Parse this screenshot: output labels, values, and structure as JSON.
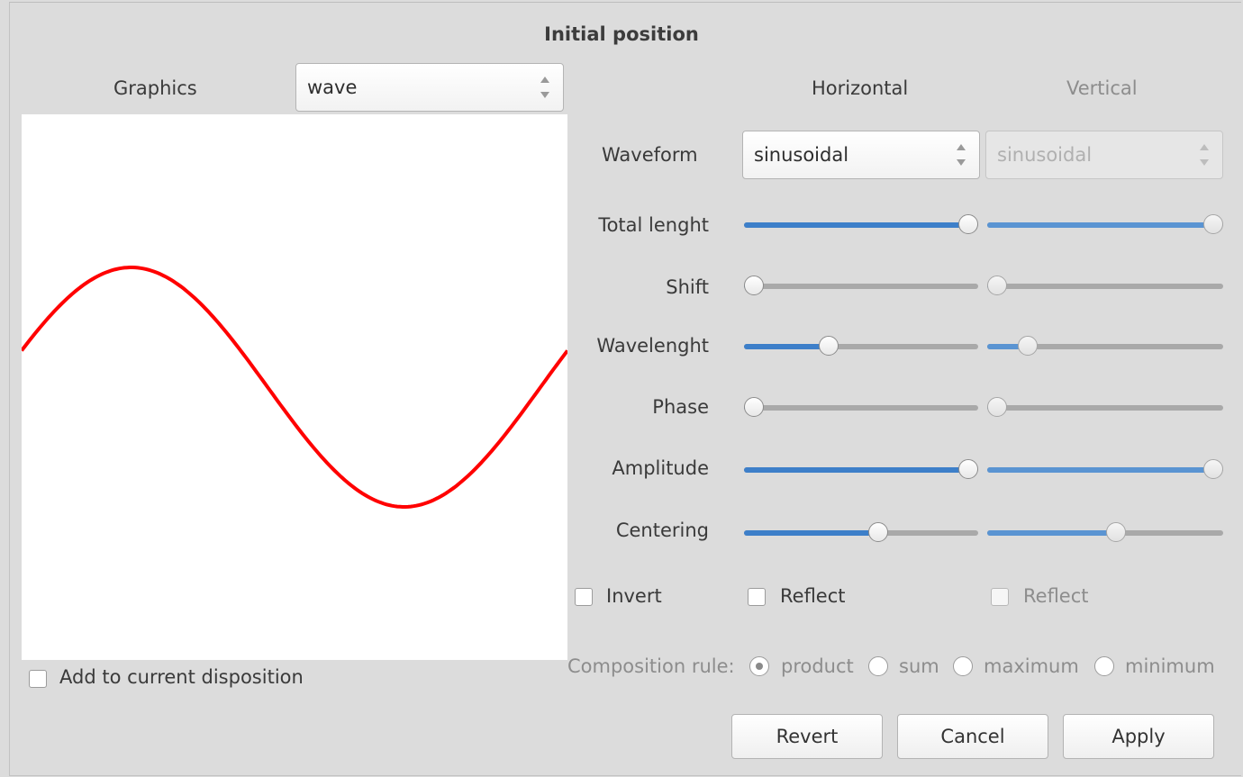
{
  "dialog": {
    "title": "Initial position"
  },
  "graphics": {
    "label": "Graphics",
    "selected": "wave"
  },
  "columns": {
    "horizontal": "Horizontal",
    "vertical": "Vertical"
  },
  "waveform": {
    "label": "Waveform",
    "horizontal": "sinusoidal",
    "vertical": "sinusoidal"
  },
  "sliders": [
    {
      "label": "Total lenght",
      "horizontal": 1.0,
      "vertical": 1.0
    },
    {
      "label": "Shift",
      "horizontal": 0.0,
      "vertical": 0.0
    },
    {
      "label": "Wavelenght",
      "horizontal": 0.35,
      "vertical": 0.14
    },
    {
      "label": "Phase",
      "horizontal": 0.0,
      "vertical": 0.0
    },
    {
      "label": "Amplitude",
      "horizontal": 1.0,
      "vertical": 1.0
    },
    {
      "label": "Centering",
      "horizontal": 0.58,
      "vertical": 0.55
    }
  ],
  "checks": {
    "invert": {
      "label": "Invert",
      "checked": false
    },
    "reflect_h": {
      "label": "Reflect",
      "checked": false
    },
    "reflect_v": {
      "label": "Reflect",
      "checked": false
    },
    "add_to_disposition": {
      "label": "Add to current disposition",
      "checked": false
    }
  },
  "composition": {
    "label": "Composition rule:",
    "options": [
      "product",
      "sum",
      "maximum",
      "minimum"
    ],
    "selected": "product"
  },
  "buttons": {
    "revert": "Revert",
    "cancel": "Cancel",
    "apply": "Apply"
  },
  "colors": {
    "wave": "#ff0000",
    "slider_fill": "#3d7fc9"
  }
}
